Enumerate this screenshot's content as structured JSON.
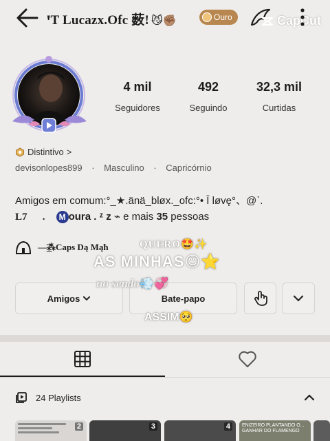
{
  "header": {
    "title": "ꞌT Lucazx.Ofc 薮!",
    "title_emojis": "😼✊🏽",
    "badge_label": "Ouro",
    "watermark": "CapCut"
  },
  "stats": [
    {
      "value": "4 mil",
      "label": "Seguidores"
    },
    {
      "value": "492",
      "label": "Seguindo"
    },
    {
      "value": "32,3 mil",
      "label": "Curtidas"
    }
  ],
  "badge_row": {
    "label": "Distintivo",
    "chevron": ">"
  },
  "info": {
    "username": "devisonlopes899",
    "gender": "Masculino",
    "sign": "Capricórnio",
    "separator": "·"
  },
  "friends": {
    "line1": "Amigos em comum:°_★.änä_bløx._ofc:°• Ī løvę°、@ˋ.",
    "l7": "L7",
    "dot": ".",
    "m_letter": "M",
    "moura": "oura . ᶻ z ⌁",
    "tail_pre": "e mais",
    "tail_count": "35",
    "tail_post": "pessoas"
  },
  "community": {
    "text": "—͟͞⁂Caps Dą Mąħ"
  },
  "overlay": {
    "quero": "QUERO",
    "quero_emoji": "🤩✨",
    "minhas": "AS MINHAS",
    "minhas_emoji": "😊⭐",
    "cursive": "no sendo",
    "cursive_emoji": "💨💞",
    "assim": "ASSIM",
    "assim_emoji": "🥺"
  },
  "buttons": {
    "friends": "Amigos",
    "chat": "Bate-papo"
  },
  "playlists": {
    "title": "24 Playlists",
    "thumbs": [
      {
        "num": "2"
      },
      {
        "num": "3"
      },
      {
        "num": "4"
      },
      {
        "num": "",
        "caption": "ENIZEIRO PLANTANDO O... GANHAR DO FLAMENGO"
      },
      {
        "num": ""
      }
    ]
  },
  "colors": {
    "background": "#efedeb",
    "badge": "#b8874f",
    "text": "#1c1c1c"
  }
}
